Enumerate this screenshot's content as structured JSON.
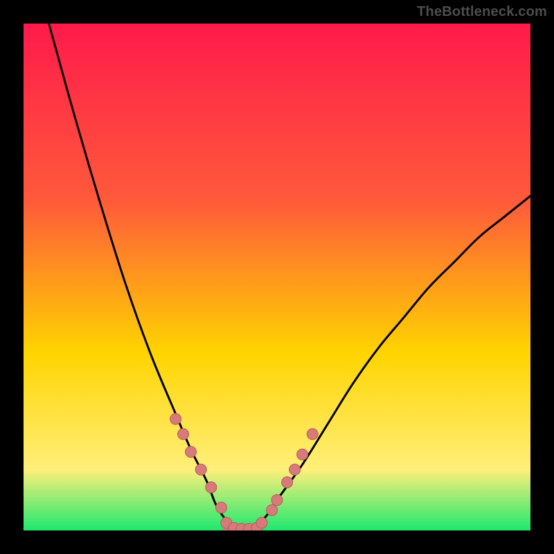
{
  "watermark": "TheBottleneck.com",
  "colors": {
    "gradient_top": "#ff1a4b",
    "gradient_mid1": "#ff5a3a",
    "gradient_mid2": "#ffd400",
    "gradient_mid3": "#ffef7a",
    "gradient_bottom": "#1ee86f",
    "curve": "#000000",
    "marker_fill": "#d77a7a",
    "marker_stroke": "#b85a5a"
  },
  "chart_data": {
    "type": "line",
    "title": "",
    "xlabel": "",
    "ylabel": "",
    "xlim": [
      0,
      100
    ],
    "ylim": [
      0,
      100
    ],
    "grid": false,
    "legend": false,
    "background": "rainbow-gradient",
    "series": [
      {
        "name": "bottleneck-curve",
        "comment": "V-shaped curve; y is approximate bottleneck percentage vs. some parameter x. Min ~0 near x≈40–46.",
        "x": [
          5,
          10,
          15,
          20,
          25,
          30,
          33,
          36,
          38,
          40,
          42,
          44,
          46,
          48,
          50,
          55,
          60,
          65,
          70,
          75,
          80,
          85,
          90,
          95,
          100
        ],
        "y": [
          100,
          82,
          65,
          49,
          35,
          23,
          16,
          10,
          5,
          2,
          0,
          0,
          1,
          3,
          6,
          13,
          21,
          29,
          36,
          42,
          48,
          53,
          58,
          62,
          66
        ]
      }
    ],
    "markers": {
      "name": "sample-points",
      "comment": "Salmon dots clustered along the lower part of the V plus a short flat run at the bottom.",
      "x": [
        30,
        31.5,
        33,
        35,
        37,
        39,
        40,
        41.5,
        43,
        44.5,
        46,
        47,
        49,
        50,
        52,
        53.5,
        55,
        57
      ],
      "y": [
        22,
        19,
        15.5,
        12,
        8.5,
        4.5,
        1.5,
        0.5,
        0.3,
        0.3,
        0.5,
        1.5,
        4,
        6,
        9.5,
        12,
        15,
        19
      ]
    },
    "flat_bottom": {
      "x0": 40,
      "x1": 46,
      "y": 0.3
    }
  }
}
